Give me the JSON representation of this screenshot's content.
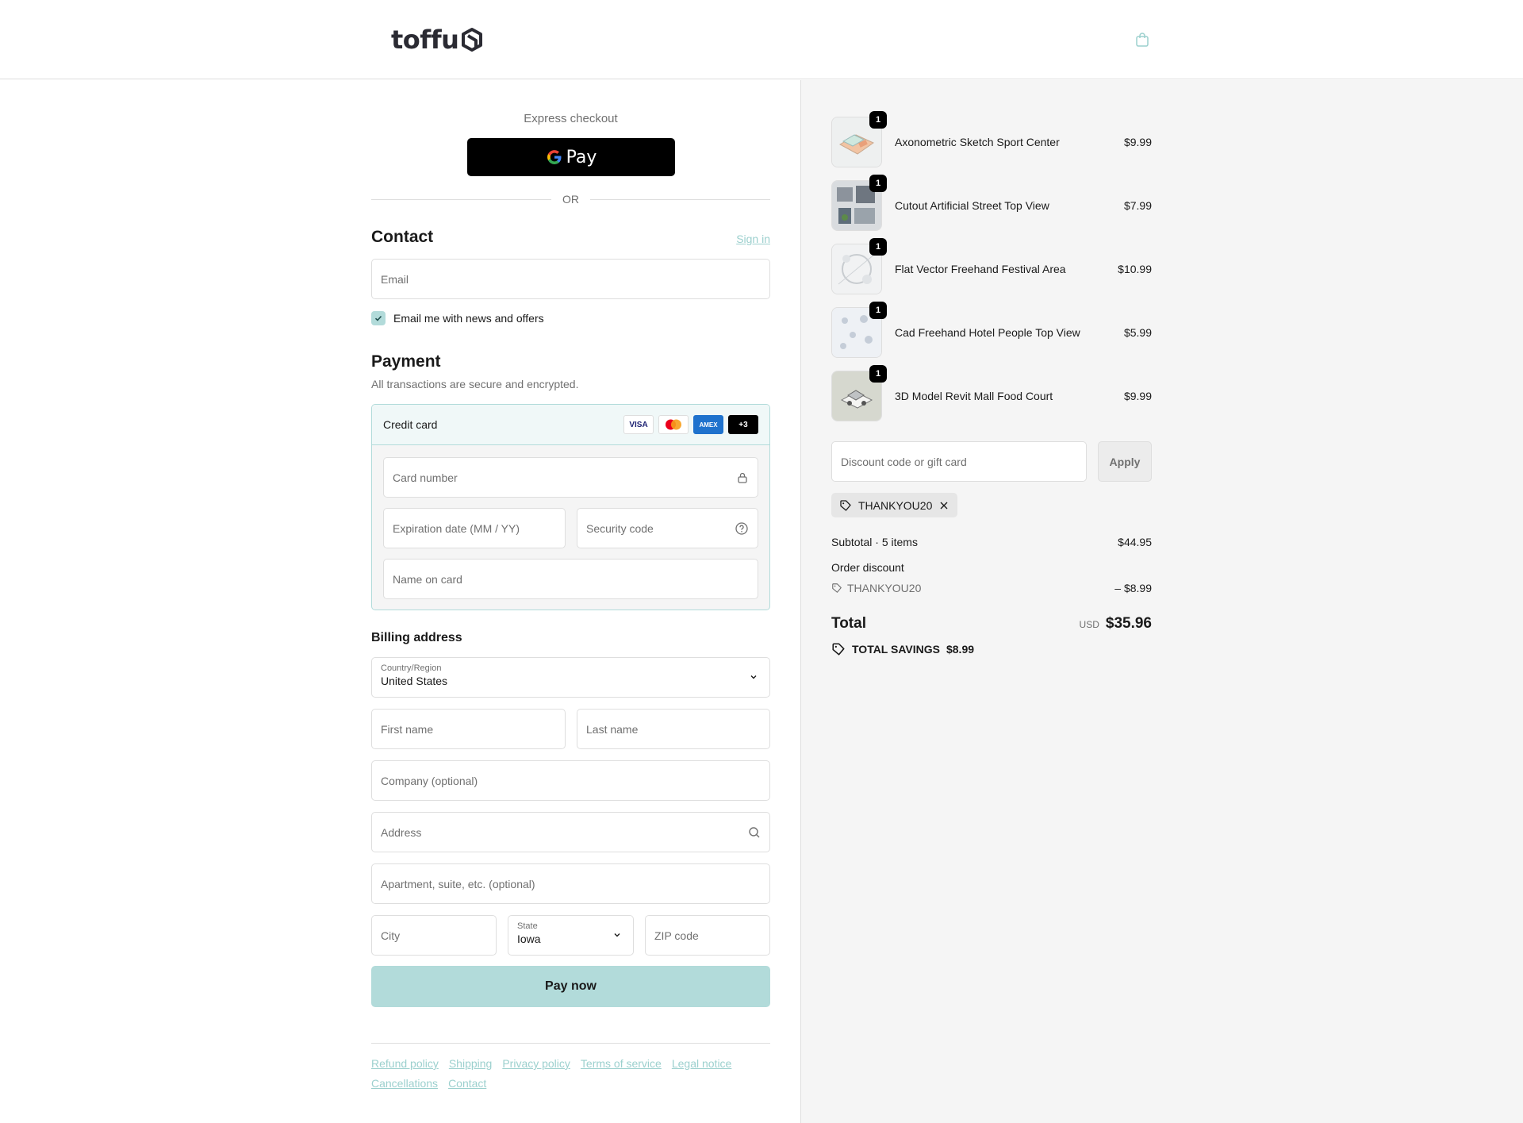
{
  "header": {
    "logo_text": "toffu",
    "cart_icon": "shopping-bag-icon"
  },
  "express": {
    "label": "Express checkout",
    "gpay_label": "Pay",
    "or_label": "OR"
  },
  "contact": {
    "title": "Contact",
    "sign_in": "Sign in",
    "email_placeholder": "Email",
    "newsletter_label": "Email me with news and offers",
    "newsletter_checked": true
  },
  "payment": {
    "title": "Payment",
    "subtitle": "All transactions are secure and encrypted.",
    "method_label": "Credit card",
    "card_brands": [
      "VISA",
      "",
      "AMEX",
      "+3"
    ],
    "card_number_placeholder": "Card number",
    "expiry_placeholder": "Expiration date (MM / YY)",
    "security_placeholder": "Security code",
    "name_placeholder": "Name on card"
  },
  "billing": {
    "title": "Billing address",
    "country_label": "Country/Region",
    "country_value": "United States",
    "first_name_placeholder": "First name",
    "last_name_placeholder": "Last name",
    "company_placeholder": "Company (optional)",
    "address_placeholder": "Address",
    "apartment_placeholder": "Apartment, suite, etc. (optional)",
    "city_placeholder": "City",
    "state_label": "State",
    "state_value": "Iowa",
    "zip_placeholder": "ZIP code"
  },
  "pay_now_label": "Pay now",
  "footer_links": [
    "Refund policy",
    "Shipping",
    "Privacy policy",
    "Terms of service",
    "Legal notice",
    "Cancellations",
    "Contact"
  ],
  "cart": {
    "items": [
      {
        "name": "Axonometric Sketch Sport Center",
        "price": "$9.99",
        "qty": "1"
      },
      {
        "name": "Cutout Artificial Street Top View",
        "price": "$7.99",
        "qty": "1"
      },
      {
        "name": "Flat Vector Freehand Festival Area",
        "price": "$10.99",
        "qty": "1"
      },
      {
        "name": "Cad Freehand Hotel People Top View",
        "price": "$5.99",
        "qty": "1"
      },
      {
        "name": "3D Model Revit Mall Food Court",
        "price": "$9.99",
        "qty": "1"
      }
    ],
    "discount_placeholder": "Discount code or gift card",
    "apply_label": "Apply",
    "applied_code": "THANKYOU20",
    "subtotal_label": "Subtotal · 5 items",
    "subtotal_value": "$44.95",
    "order_discount_label": "Order discount",
    "discount_code": "THANKYOU20",
    "discount_value": "– $8.99",
    "total_label": "Total",
    "currency": "USD",
    "total_value": "$35.96",
    "savings_label": "TOTAL SAVINGS",
    "savings_value": "$8.99"
  },
  "colors": {
    "accent": "#b2dbda",
    "link": "#9cd0ce"
  }
}
